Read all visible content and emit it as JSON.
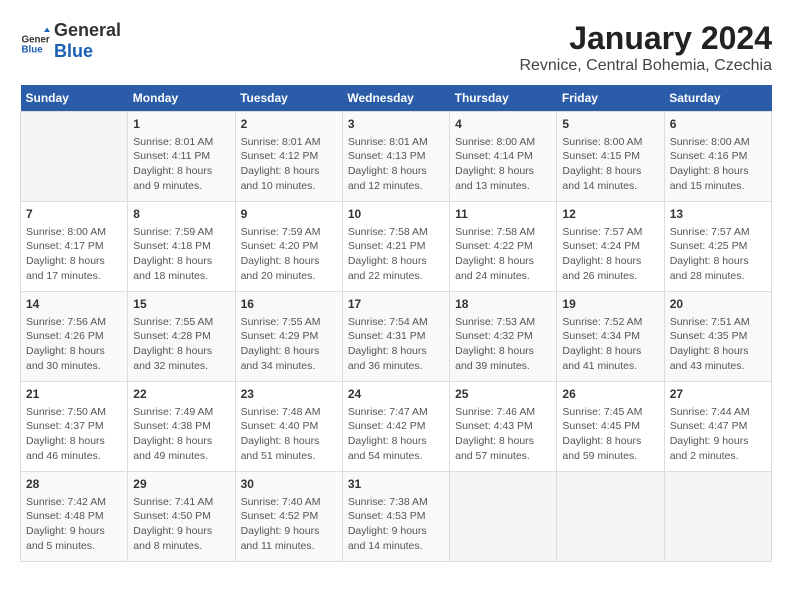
{
  "header": {
    "logo_line1": "General",
    "logo_line2": "Blue",
    "month_title": "January 2024",
    "subtitle": "Revnice, Central Bohemia, Czechia"
  },
  "weekdays": [
    "Sunday",
    "Monday",
    "Tuesday",
    "Wednesday",
    "Thursday",
    "Friday",
    "Saturday"
  ],
  "weeks": [
    [
      {
        "day": "",
        "info": ""
      },
      {
        "day": "1",
        "info": "Sunrise: 8:01 AM\nSunset: 4:11 PM\nDaylight: 8 hours\nand 9 minutes."
      },
      {
        "day": "2",
        "info": "Sunrise: 8:01 AM\nSunset: 4:12 PM\nDaylight: 8 hours\nand 10 minutes."
      },
      {
        "day": "3",
        "info": "Sunrise: 8:01 AM\nSunset: 4:13 PM\nDaylight: 8 hours\nand 12 minutes."
      },
      {
        "day": "4",
        "info": "Sunrise: 8:00 AM\nSunset: 4:14 PM\nDaylight: 8 hours\nand 13 minutes."
      },
      {
        "day": "5",
        "info": "Sunrise: 8:00 AM\nSunset: 4:15 PM\nDaylight: 8 hours\nand 14 minutes."
      },
      {
        "day": "6",
        "info": "Sunrise: 8:00 AM\nSunset: 4:16 PM\nDaylight: 8 hours\nand 15 minutes."
      }
    ],
    [
      {
        "day": "7",
        "info": "Sunrise: 8:00 AM\nSunset: 4:17 PM\nDaylight: 8 hours\nand 17 minutes."
      },
      {
        "day": "8",
        "info": "Sunrise: 7:59 AM\nSunset: 4:18 PM\nDaylight: 8 hours\nand 18 minutes."
      },
      {
        "day": "9",
        "info": "Sunrise: 7:59 AM\nSunset: 4:20 PM\nDaylight: 8 hours\nand 20 minutes."
      },
      {
        "day": "10",
        "info": "Sunrise: 7:58 AM\nSunset: 4:21 PM\nDaylight: 8 hours\nand 22 minutes."
      },
      {
        "day": "11",
        "info": "Sunrise: 7:58 AM\nSunset: 4:22 PM\nDaylight: 8 hours\nand 24 minutes."
      },
      {
        "day": "12",
        "info": "Sunrise: 7:57 AM\nSunset: 4:24 PM\nDaylight: 8 hours\nand 26 minutes."
      },
      {
        "day": "13",
        "info": "Sunrise: 7:57 AM\nSunset: 4:25 PM\nDaylight: 8 hours\nand 28 minutes."
      }
    ],
    [
      {
        "day": "14",
        "info": "Sunrise: 7:56 AM\nSunset: 4:26 PM\nDaylight: 8 hours\nand 30 minutes."
      },
      {
        "day": "15",
        "info": "Sunrise: 7:55 AM\nSunset: 4:28 PM\nDaylight: 8 hours\nand 32 minutes."
      },
      {
        "day": "16",
        "info": "Sunrise: 7:55 AM\nSunset: 4:29 PM\nDaylight: 8 hours\nand 34 minutes."
      },
      {
        "day": "17",
        "info": "Sunrise: 7:54 AM\nSunset: 4:31 PM\nDaylight: 8 hours\nand 36 minutes."
      },
      {
        "day": "18",
        "info": "Sunrise: 7:53 AM\nSunset: 4:32 PM\nDaylight: 8 hours\nand 39 minutes."
      },
      {
        "day": "19",
        "info": "Sunrise: 7:52 AM\nSunset: 4:34 PM\nDaylight: 8 hours\nand 41 minutes."
      },
      {
        "day": "20",
        "info": "Sunrise: 7:51 AM\nSunset: 4:35 PM\nDaylight: 8 hours\nand 43 minutes."
      }
    ],
    [
      {
        "day": "21",
        "info": "Sunrise: 7:50 AM\nSunset: 4:37 PM\nDaylight: 8 hours\nand 46 minutes."
      },
      {
        "day": "22",
        "info": "Sunrise: 7:49 AM\nSunset: 4:38 PM\nDaylight: 8 hours\nand 49 minutes."
      },
      {
        "day": "23",
        "info": "Sunrise: 7:48 AM\nSunset: 4:40 PM\nDaylight: 8 hours\nand 51 minutes."
      },
      {
        "day": "24",
        "info": "Sunrise: 7:47 AM\nSunset: 4:42 PM\nDaylight: 8 hours\nand 54 minutes."
      },
      {
        "day": "25",
        "info": "Sunrise: 7:46 AM\nSunset: 4:43 PM\nDaylight: 8 hours\nand 57 minutes."
      },
      {
        "day": "26",
        "info": "Sunrise: 7:45 AM\nSunset: 4:45 PM\nDaylight: 8 hours\nand 59 minutes."
      },
      {
        "day": "27",
        "info": "Sunrise: 7:44 AM\nSunset: 4:47 PM\nDaylight: 9 hours\nand 2 minutes."
      }
    ],
    [
      {
        "day": "28",
        "info": "Sunrise: 7:42 AM\nSunset: 4:48 PM\nDaylight: 9 hours\nand 5 minutes."
      },
      {
        "day": "29",
        "info": "Sunrise: 7:41 AM\nSunset: 4:50 PM\nDaylight: 9 hours\nand 8 minutes."
      },
      {
        "day": "30",
        "info": "Sunrise: 7:40 AM\nSunset: 4:52 PM\nDaylight: 9 hours\nand 11 minutes."
      },
      {
        "day": "31",
        "info": "Sunrise: 7:38 AM\nSunset: 4:53 PM\nDaylight: 9 hours\nand 14 minutes."
      },
      {
        "day": "",
        "info": ""
      },
      {
        "day": "",
        "info": ""
      },
      {
        "day": "",
        "info": ""
      }
    ]
  ]
}
